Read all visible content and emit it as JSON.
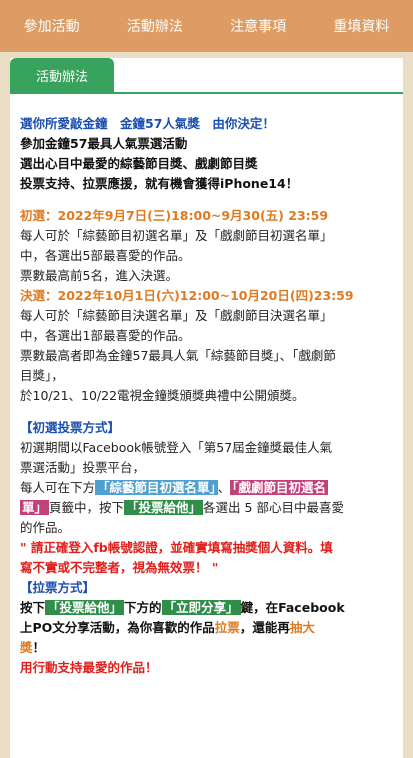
{
  "nav": {
    "items": [
      "參加活動",
      "活動辦法",
      "注意事項",
      "重填資料"
    ]
  },
  "section": {
    "title": "活動辦法"
  },
  "intro": {
    "line1": "選你所愛敲金鐘　金鐘57人氣獎　由你決定！",
    "line2": "參加金鐘57最具人氣票選活動",
    "line3": "選出心目中最愛的綜藝節目獎、戲劇節目獎",
    "line4": "投票支持、拉票應援，就有機會獲得iPhone14！"
  },
  "prelim": {
    "heading": "初選：2022年9月7日(三)18:00~9月30(五) 23:59",
    "body1": "每人可於「綜藝節目初選名單」及「戲劇節目初選名單」",
    "body2": "中，各選出5部最喜愛的作品。",
    "body3": "票數最高前5名，進入決選。"
  },
  "final": {
    "heading": "決選：2022年10月1日(六)12:00~10月20日(四)23:59",
    "body1": "每人可於「綜藝節目決選名單」及「戲劇節目決選名單」",
    "body2": "中，各選出1部最喜愛的作品。",
    "body3": "票數最高者即為金鐘57最具人氣「綜藝節目獎」、「戲劇節",
    "body4": "目獎」，",
    "body5": "於10/21、10/22電視金鐘獎頒獎典禮中公開頒獎。"
  },
  "voting": {
    "heading": "【初選投票方式】",
    "line1": "初選期間以Facebook帳號登入「第57屆金鐘獎最佳人氣",
    "line2": "票選活動」投票平台，",
    "line3_pre": "每人可在下方",
    "tag_variety": "「綜藝節目初選名單」",
    "sep": "、",
    "tag_drama_a": "「戲劇節目初選名",
    "tag_drama_b": "單」",
    "line4_mid": "頁籤中，按下",
    "tag_vote": "「投票給他」",
    "line4_post": "各選出 5 部心目中最喜愛",
    "line5": "的作品。",
    "warn1": "\" 請正確登入fb帳號認證，並確實填寫抽獎個人資料。填",
    "warn2": "寫不實或不完整者，視為無效票！ \""
  },
  "canvass": {
    "heading": "【拉票方式】",
    "pre": "按下",
    "tag_vote": "「投票給他」",
    "mid": "下方的",
    "tag_share": "「立即分享」",
    "post1": "鍵，在Facebook",
    "line2_a": "上PO文分享活動，為你喜歡的作品",
    "word_canvass": "拉票",
    "line2_b": "，還能再",
    "word_lottery": "抽大",
    "line3_a": "獎",
    "line3_b": "！",
    "closing": "用行動支持最愛的作品！"
  }
}
